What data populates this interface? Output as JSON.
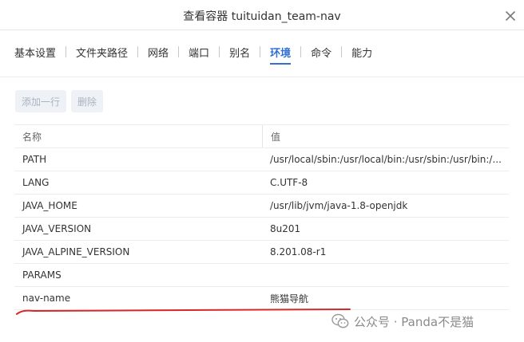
{
  "dialog": {
    "title": "查看容器 tuituidan_team-nav"
  },
  "tabs": [
    {
      "label": "基本设置",
      "active": false
    },
    {
      "label": "文件夹路径",
      "active": false
    },
    {
      "label": "网络",
      "active": false
    },
    {
      "label": "端口",
      "active": false
    },
    {
      "label": "别名",
      "active": false
    },
    {
      "label": "环境",
      "active": true
    },
    {
      "label": "命令",
      "active": false
    },
    {
      "label": "能力",
      "active": false
    }
  ],
  "toolbar": {
    "add_row_label": "添加一行",
    "delete_label": "删除"
  },
  "table": {
    "headers": {
      "name": "名称",
      "value": "值"
    },
    "rows": [
      {
        "name": "PATH",
        "value": "/usr/local/sbin:/usr/local/bin:/usr/sbin:/usr/bin:/..."
      },
      {
        "name": "LANG",
        "value": "C.UTF-8"
      },
      {
        "name": "JAVA_HOME",
        "value": "/usr/lib/jvm/java-1.8-openjdk"
      },
      {
        "name": "JAVA_VERSION",
        "value": "8u201"
      },
      {
        "name": "JAVA_ALPINE_VERSION",
        "value": "8.201.08-r1"
      },
      {
        "name": "PARAMS",
        "value": ""
      },
      {
        "name": "nav-name",
        "value": "熊猫导航"
      }
    ]
  },
  "watermark": {
    "text": "公众号 · Panda不是猫"
  },
  "colors": {
    "accent": "#2f6fd6",
    "annotation": "#d9262b"
  }
}
